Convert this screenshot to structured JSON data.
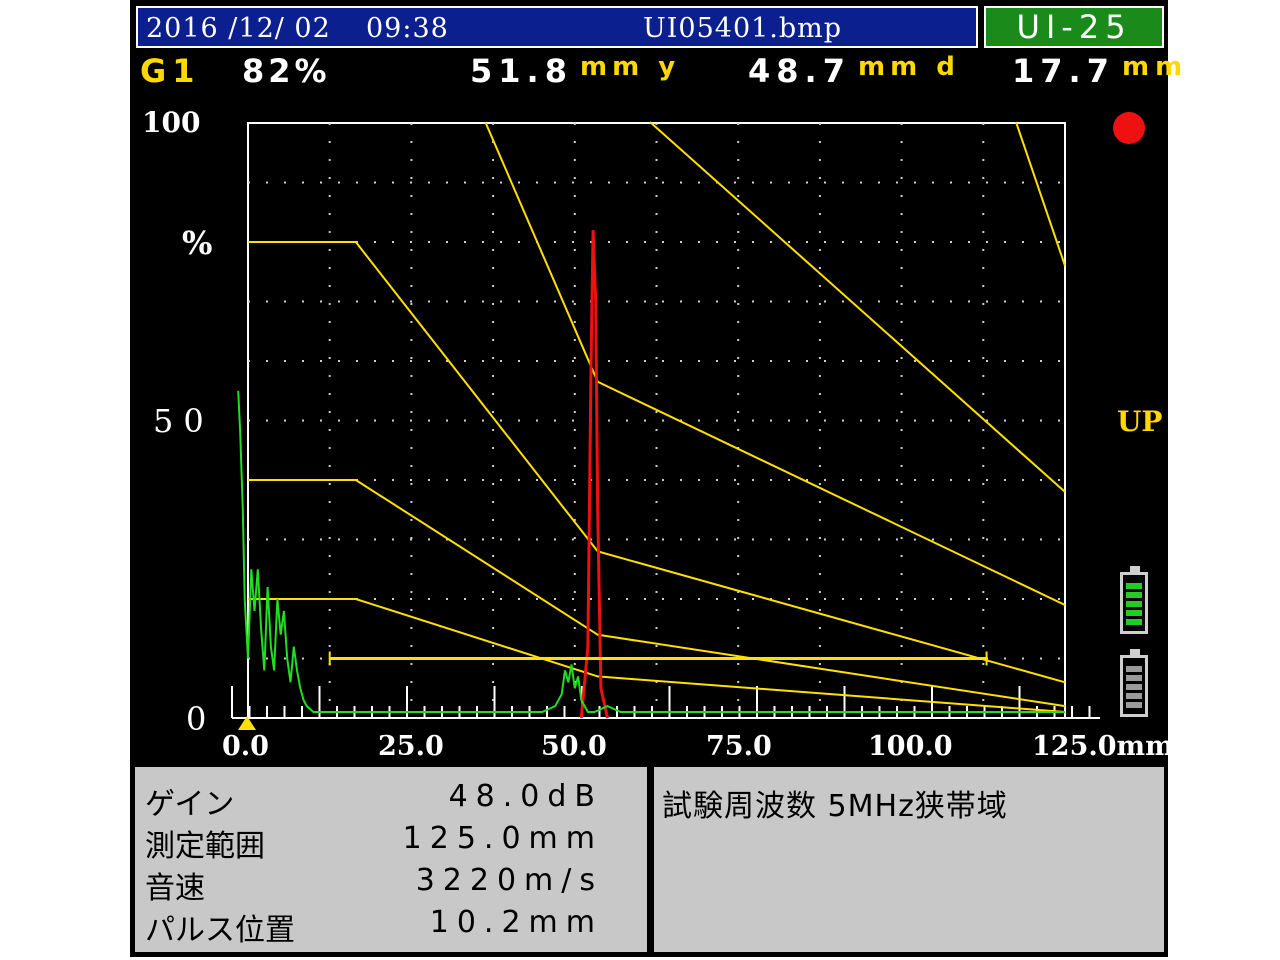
{
  "header": {
    "date": "2016 /12/ 02",
    "time": "09:38",
    "filename": "UI05401.bmp",
    "model": "UI-25"
  },
  "readouts": {
    "gate": "G1",
    "gate_percent": "82%",
    "y_value": "51.8",
    "y_unit": "mm y",
    "d_value": "48.7",
    "d_unit": "mm d",
    "third_value": "17.7",
    "third_unit": "mm"
  },
  "indicators": {
    "mode_label": "UP",
    "record_dot_color": "#ee1111",
    "battery_main_color": "#22cc22"
  },
  "chart_data": {
    "type": "line",
    "x_tick_labels": [
      "0.0",
      "25.0",
      "50.0",
      "75.0",
      "100.0",
      "125.0mm"
    ],
    "y_tick_labels": [
      "100",
      "%",
      "50",
      "0"
    ],
    "xlim": [
      0,
      125
    ],
    "ylim": [
      0,
      100
    ],
    "grid": true,
    "series": [
      {
        "color": "#ffe000",
        "x": [
          0,
          16.5,
          53.5,
          125
        ],
        "y": [
          80,
          80,
          28,
          6
        ]
      },
      {
        "color": "#ffe000",
        "x": [
          0,
          16.5,
          53.5,
          125
        ],
        "y": [
          40,
          40,
          14,
          2
        ]
      },
      {
        "color": "#ffe000",
        "x": [
          0,
          16.5,
          53.5,
          125
        ],
        "y": [
          20,
          20,
          7,
          1
        ]
      },
      {
        "color": "#ffe000",
        "x": [
          36.3,
          53.5,
          125
        ],
        "y": [
          105,
          56.5,
          19
        ]
      },
      {
        "color": "#ffe000",
        "x": [
          61.5,
          125
        ],
        "y": [
          105,
          38
        ]
      },
      {
        "color": "#ffe000",
        "x": [
          117.5,
          125
        ],
        "y": [
          105,
          76
        ]
      },
      {
        "color": "#ee1111",
        "x": [
          51.0,
          52.0,
          52.5,
          52.8,
          53.2,
          53.5,
          54.0,
          55.0
        ],
        "y": [
          0,
          12,
          60,
          82,
          70,
          35,
          5,
          0
        ]
      },
      {
        "color": "#22dd22",
        "x": [
          -1.5,
          -1.2,
          -0.8,
          -0.5,
          0.0,
          0.5,
          1.0,
          1.5,
          2.0,
          2.5,
          3.0,
          3.5,
          4.0,
          4.5,
          5.0,
          5.5,
          6.0,
          6.5,
          7.0,
          7.5,
          8.0,
          8.5,
          9.0,
          10.0,
          11.0,
          12.0,
          15.0,
          20.0,
          25.0,
          30.0,
          35.0,
          40.0,
          45.0,
          47.0,
          48.0,
          48.5,
          49.0,
          49.5,
          50.0,
          50.5,
          51.0,
          51.5,
          52.0,
          53.0,
          55.0,
          57.0,
          60.0,
          65.0,
          70.0,
          75.0,
          80.0,
          85.0,
          90.0,
          95.0,
          100.0,
          105.0,
          110.0,
          115.0,
          120.0,
          125.0
        ],
        "y": [
          55,
          48,
          35,
          20,
          10,
          25,
          18,
          25,
          15,
          8,
          22,
          12,
          8,
          20,
          14,
          18,
          10,
          6,
          12,
          8,
          5,
          3,
          2,
          1,
          1,
          1,
          1,
          1,
          1,
          1,
          1,
          1,
          1,
          2,
          4,
          8,
          6,
          9,
          5,
          7,
          3,
          2,
          1,
          1,
          2,
          1,
          1,
          1,
          1,
          1,
          1,
          1,
          1,
          1,
          1,
          1,
          1,
          1,
          1,
          1
        ]
      }
    ],
    "gate_bar": {
      "x_start": 12.5,
      "x_end": 113,
      "y": 10
    }
  },
  "settings": {
    "rows": [
      {
        "label": "ゲイン",
        "value": "48.0dB"
      },
      {
        "label": "測定範囲",
        "value": "125.0mm"
      },
      {
        "label": "音速",
        "value": "3220m/s"
      },
      {
        "label": "パルス位置",
        "value": "10.2mm"
      }
    ],
    "frequency": "試験周波数 5MHz狭帯域"
  }
}
